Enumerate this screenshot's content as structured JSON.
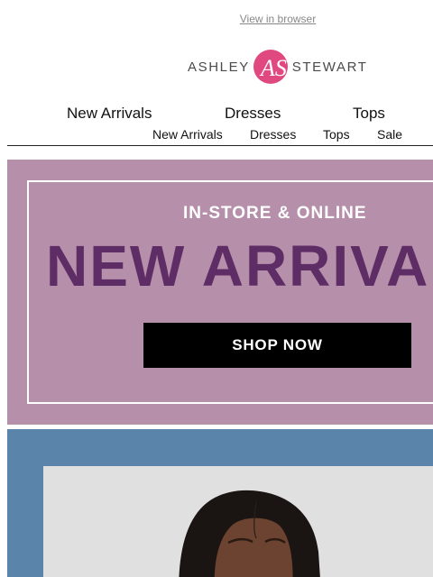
{
  "header": {
    "view_in_browser": "View in browser",
    "logo_left": "ASHLEY",
    "logo_right": "STEWART",
    "logo_mark_letters": "AS"
  },
  "nav_large": [
    {
      "label": "New Arrivals"
    },
    {
      "label": "Dresses"
    },
    {
      "label": "Tops"
    }
  ],
  "nav_small": [
    {
      "label": "New Arrivals"
    },
    {
      "label": "Dresses"
    },
    {
      "label": "Tops"
    },
    {
      "label": "Sale"
    }
  ],
  "hero": {
    "subtitle": "IN-STORE & ONLINE",
    "title": "NEW ARRIVA",
    "button_label": "SHOP NOW"
  },
  "colors": {
    "brand_pink": "#e0497f",
    "hero_bg": "#b690ab",
    "hero_title": "#5e2d66",
    "photo_bg": "#5a84a9"
  }
}
